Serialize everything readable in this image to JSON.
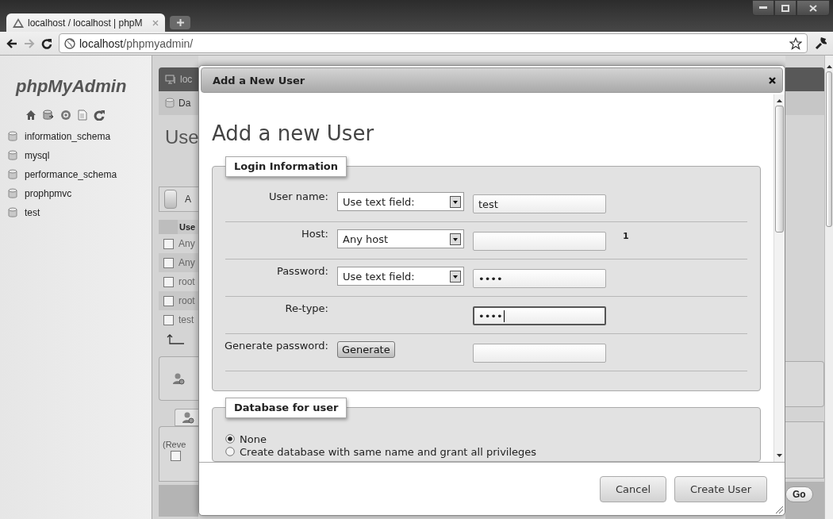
{
  "browser": {
    "tab_title": "localhost / localhost | phpM",
    "url_host": "localhost",
    "url_path": "/phpmyadmin/"
  },
  "sidebar": {
    "logo": "phpMyAdmin",
    "databases": [
      "information_schema",
      "mysql",
      "performance_schema",
      "prophpmvc",
      "test"
    ]
  },
  "background_page": {
    "server_tab": "loc",
    "subtab": "Da",
    "heading": "Use",
    "action_button": "A",
    "table": {
      "column_1": "Use",
      "rows": [
        {
          "text": "Any",
          "checked": false
        },
        {
          "text": "Any",
          "checked": false
        },
        {
          "text": "root",
          "checked": false
        },
        {
          "text": "root",
          "checked": false
        },
        {
          "text": "test",
          "checked": false
        }
      ]
    },
    "revoke_note": "(Reve",
    "revoke_checked": false,
    "go_button": "Go"
  },
  "dialog": {
    "title": "Add a New User",
    "heading": "Add a new User",
    "login": {
      "legend": "Login Information",
      "rows": [
        {
          "kind": "select_input",
          "label": "User name:",
          "select": "Use text field:",
          "value": "test",
          "focused": false
        },
        {
          "kind": "select_input",
          "label": "Host:",
          "select": "Any host",
          "note": "1",
          "focused": false
        },
        {
          "kind": "select_input",
          "label": "Password:",
          "select": "Use text field:",
          "value": "••••",
          "focused": false
        },
        {
          "kind": "input",
          "label": "Re-type:",
          "value": "••••",
          "focused": true
        },
        {
          "kind": "button_input",
          "label": "Generate password:",
          "button": "Generate",
          "focused": false
        }
      ]
    },
    "database": {
      "legend": "Database for user",
      "options": [
        {
          "label": "None",
          "selected": true
        },
        {
          "label": "Create database with same name and grant all privileges",
          "selected": false
        }
      ]
    },
    "buttons": [
      "Cancel",
      "Create User"
    ]
  }
}
